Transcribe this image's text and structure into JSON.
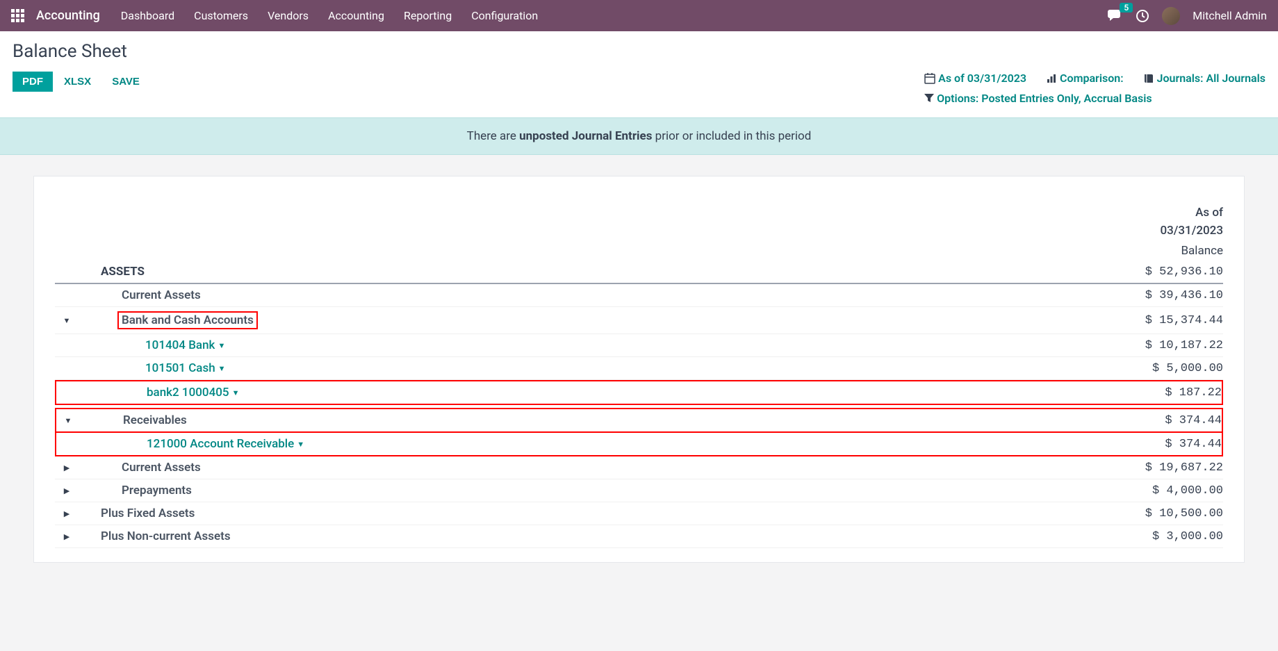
{
  "navbar": {
    "app_name": "Accounting",
    "links": [
      "Dashboard",
      "Customers",
      "Vendors",
      "Accounting",
      "Reporting",
      "Configuration"
    ],
    "msg_count": "5",
    "user_name": "Mitchell Admin"
  },
  "page": {
    "title": "Balance Sheet",
    "buttons": {
      "pdf": "PDF",
      "xlsx": "XLSX",
      "save": "SAVE"
    },
    "filters": {
      "asof": "As of 03/31/2023",
      "comparison": "Comparison:",
      "journals": "Journals: All Journals",
      "options_label": "Options:",
      "options_value": "Posted Entries Only, Accrual Basis"
    },
    "banner_prefix": "There are ",
    "banner_bold": "unposted Journal Entries",
    "banner_suffix": " prior or included in this period"
  },
  "report": {
    "col_header_line1": "As of",
    "col_header_line2": "03/31/2023",
    "balance_label": "Balance",
    "rows": {
      "assets": {
        "label": "ASSETS",
        "value": "$ 52,936.10"
      },
      "current_assets": {
        "label": "Current Assets",
        "value": "$ 39,436.10"
      },
      "bank_cash": {
        "label": "Bank and Cash Accounts",
        "value": "$ 15,374.44"
      },
      "bank_101404": {
        "label": "101404 Bank",
        "value": "$ 10,187.22"
      },
      "cash_101501": {
        "label": "101501 Cash",
        "value": "$ 5,000.00"
      },
      "bank2": {
        "label": "bank2 1000405",
        "value": "$ 187.22"
      },
      "receivables": {
        "label": "Receivables",
        "value": "$ 374.44"
      },
      "acct_recv": {
        "label": "121000 Account Receivable",
        "value": "$ 374.44"
      },
      "current_assets2": {
        "label": "Current Assets",
        "value": "$ 19,687.22"
      },
      "prepayments": {
        "label": "Prepayments",
        "value": "$ 4,000.00"
      },
      "fixed_assets": {
        "label": "Plus Fixed Assets",
        "value": "$ 10,500.00"
      },
      "noncurrent": {
        "label": "Plus Non-current Assets",
        "value": "$ 3,000.00"
      }
    }
  }
}
